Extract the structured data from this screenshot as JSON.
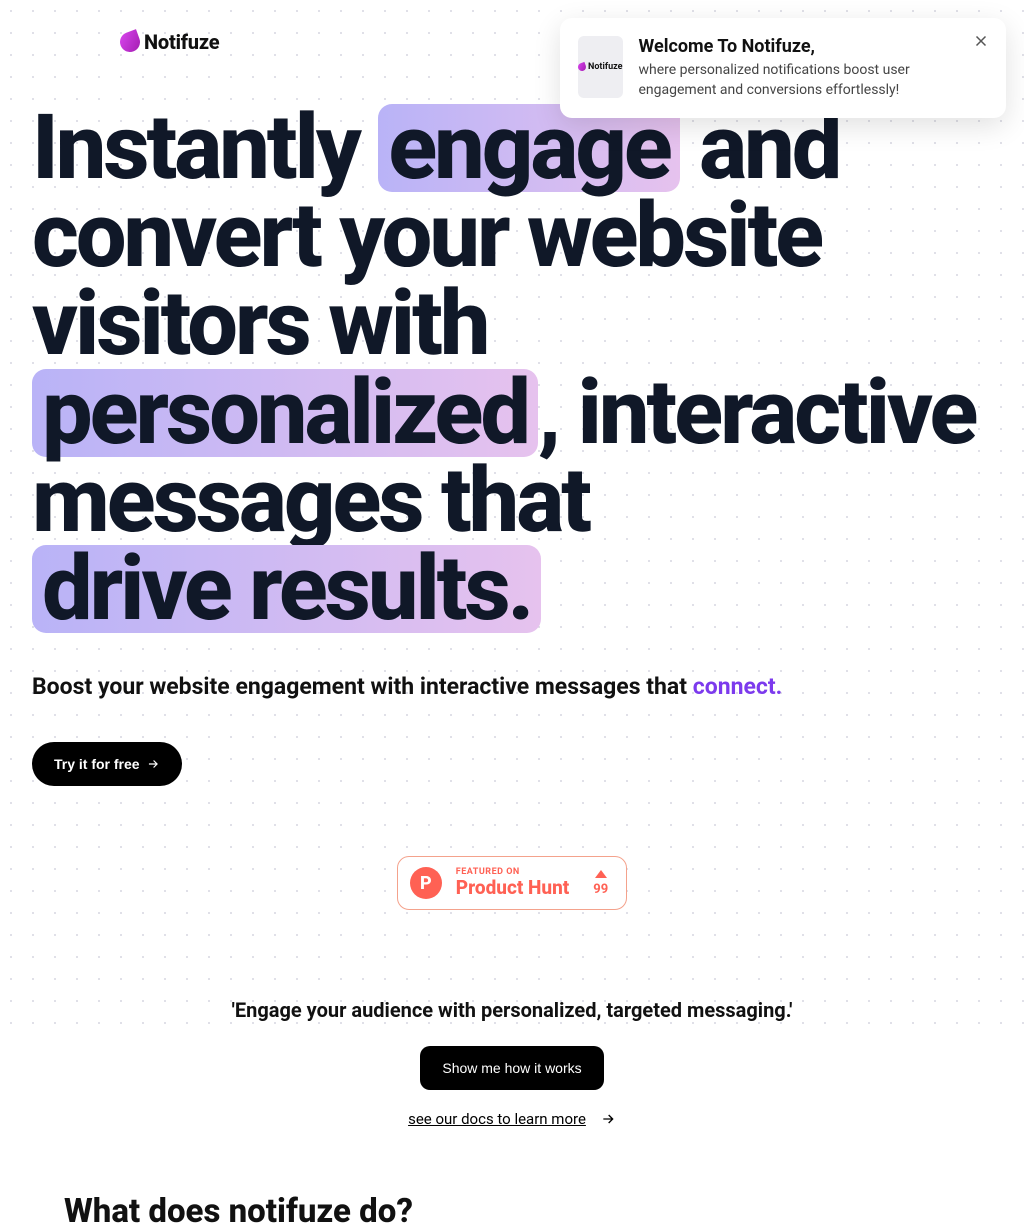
{
  "brand": {
    "name": "Notifuze"
  },
  "toast": {
    "title": "Welcome To Notifuze,",
    "body": "where personalized notifications boost user engagement and conversions effortlessly!",
    "thumb_label": "Notifuze"
  },
  "hero": {
    "headline_parts": {
      "p1": "Instantly ",
      "h1": "engage",
      "p2": " and convert your website visitors with ",
      "h2": "personalized",
      "p3": ", interactive messages that ",
      "h3": "drive results."
    },
    "subhead_prefix": "Boost your website engagement with interactive messages that  ",
    "subhead_accent": "connect.",
    "cta_label": "Try it for free"
  },
  "product_hunt": {
    "featured": "FEATURED ON",
    "name": "Product Hunt",
    "upvotes": "99",
    "letter": "P"
  },
  "mid": {
    "quote": "'Engage your audience with personalized, targeted messaging.'",
    "demo_button": "Show me how it works",
    "docs_link": "see our docs to learn more"
  },
  "section": {
    "what_title": "What does notifuze do?"
  }
}
